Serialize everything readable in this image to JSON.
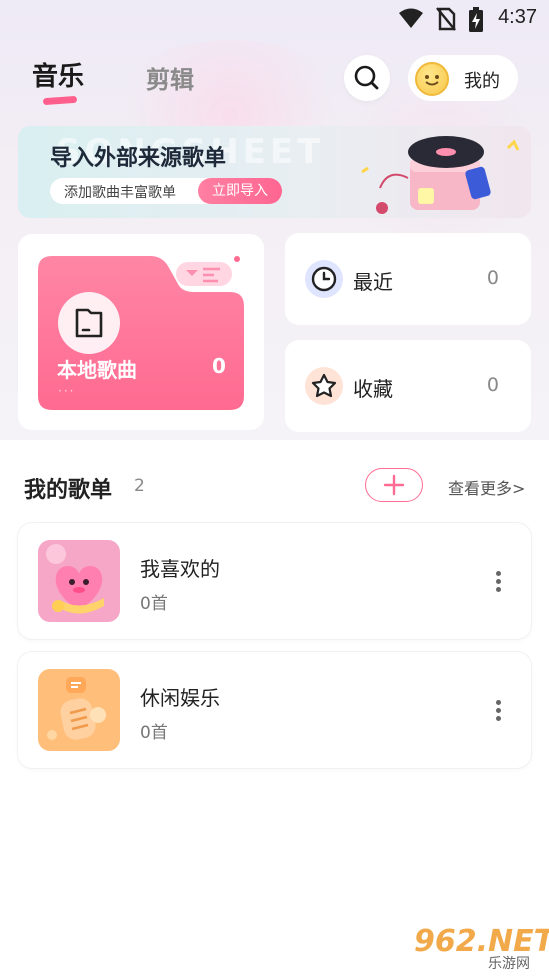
{
  "status_bar": {
    "time": "4:37",
    "icons": [
      "wifi-icon",
      "no-sim-icon",
      "battery-charging-icon"
    ]
  },
  "header": {
    "tabs": [
      {
        "label": "音乐",
        "active": true
      },
      {
        "label": "剪辑",
        "active": false
      }
    ],
    "search_icon": "search-icon",
    "mine_label": "我的"
  },
  "banner": {
    "watermark": "SONGSHEET",
    "title": "导入外部来源歌单",
    "subtitle": "添加歌曲丰富歌单",
    "cta_label": "立即导入"
  },
  "local": {
    "label": "本地歌曲",
    "count": "0",
    "dots": "···"
  },
  "recent": {
    "label": "最近",
    "count": "0",
    "icon": "clock-icon"
  },
  "favorites": {
    "label": "收藏",
    "count": "0",
    "icon": "star-icon"
  },
  "playlists": {
    "title": "我的歌单",
    "count": "2",
    "see_more": "查看更多>",
    "items": [
      {
        "name": "我喜欢的",
        "songs": "0首",
        "cover": "heart-cover"
      },
      {
        "name": "休闲娱乐",
        "songs": "0首",
        "cover": "microphone-cover"
      }
    ]
  },
  "watermark": {
    "brand": "962.NET",
    "sub": "乐游网"
  },
  "colors": {
    "accent": "#ff6691",
    "folder_pink": "#ff6e95",
    "recent_blue": "#dfe4ff",
    "fav_peach": "#ffe3d6"
  }
}
